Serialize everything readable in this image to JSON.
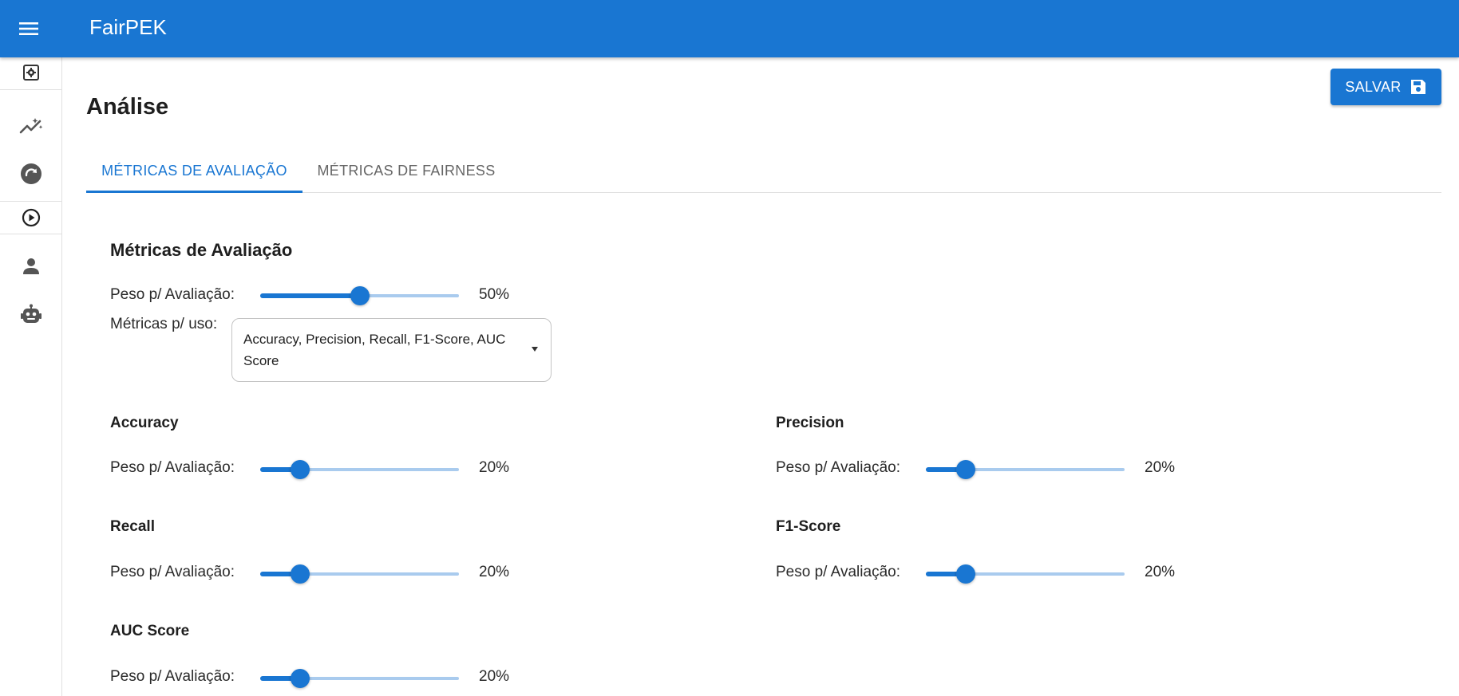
{
  "app": {
    "title": "FairPEK"
  },
  "sidebar": {
    "items": [
      {
        "icon": "settings-box-icon"
      },
      {
        "icon": "auto-graph-icon"
      },
      {
        "icon": "refresh-circle-icon"
      },
      {
        "icon": "play-circle-icon"
      },
      {
        "icon": "person-icon"
      },
      {
        "icon": "robot-icon"
      }
    ]
  },
  "page": {
    "title": "Análise",
    "save_label": "SALVAR",
    "save_icon": "save-icon"
  },
  "tabs": [
    {
      "label": "MÉTRICAS DE AVALIAÇÃO",
      "active": true
    },
    {
      "label": "MÉTRICAS DE FAIRNESS",
      "active": false
    }
  ],
  "section": {
    "title": "Métricas de Avaliação",
    "weight_label": "Peso p/ Avaliação:",
    "weight_value": 50,
    "weight_text": "50%",
    "metrics_label": "Métricas p/ uso:",
    "metrics_selected": "Accuracy, Precision, Recall, F1-Score, AUC Score"
  },
  "metrics": [
    {
      "name": "Accuracy",
      "label": "Peso p/ Avaliação:",
      "value": 20,
      "text": "20%"
    },
    {
      "name": "Precision",
      "label": "Peso p/ Avaliação:",
      "value": 20,
      "text": "20%"
    },
    {
      "name": "Recall",
      "label": "Peso p/ Avaliação:",
      "value": 20,
      "text": "20%"
    },
    {
      "name": "F1-Score",
      "label": "Peso p/ Avaliação:",
      "value": 20,
      "text": "20%"
    },
    {
      "name": "AUC Score",
      "label": "Peso p/ Avaliação:",
      "value": 20,
      "text": "20%"
    }
  ],
  "colors": {
    "primary": "#1976d2",
    "slider_rail": "#a9cbee",
    "tab_inactive": "#666666"
  }
}
